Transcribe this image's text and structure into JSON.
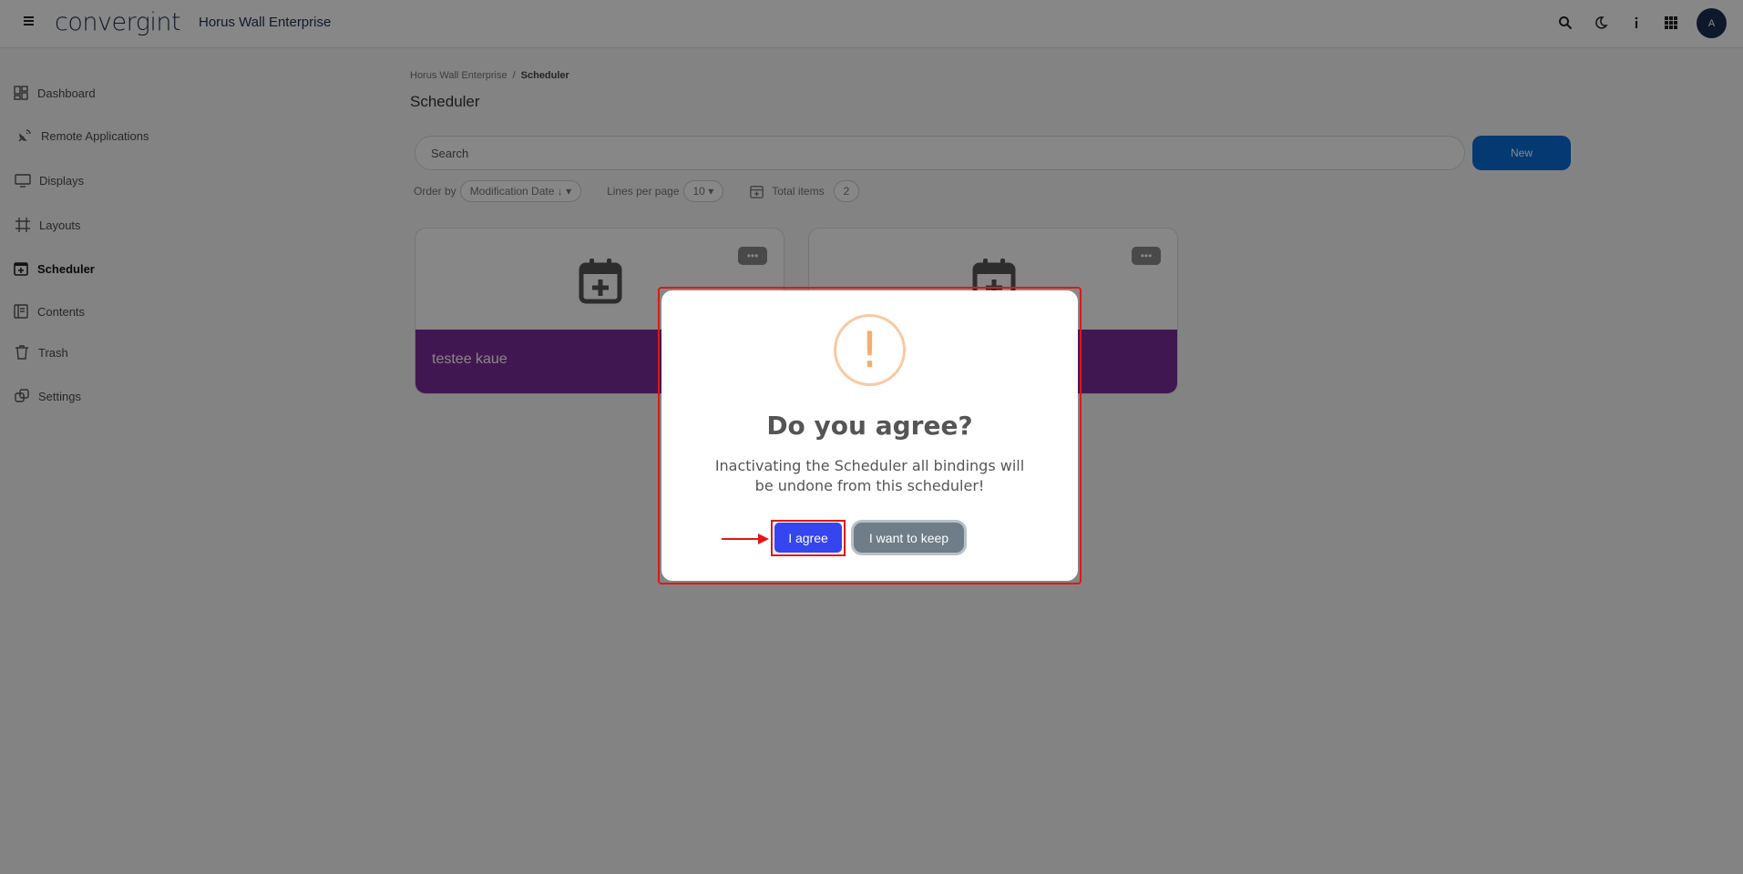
{
  "header": {
    "logo": "convergint",
    "app_title": "Horus Wall Enterprise",
    "icons": [
      "search-icon",
      "moon-icon",
      "info-icon",
      "apps-grid-icon"
    ],
    "avatar_initial": "A"
  },
  "sidebar": {
    "items": [
      {
        "label": "Dashboard",
        "icon": "dashboard-icon"
      },
      {
        "label": "Remote Applications",
        "icon": "satellite-icon"
      },
      {
        "label": "Displays",
        "icon": "monitor-icon"
      },
      {
        "label": "Layouts",
        "icon": "crop-icon"
      },
      {
        "label": "Scheduler",
        "icon": "calendar-plus-icon",
        "active": true
      },
      {
        "label": "Contents",
        "icon": "contents-icon"
      },
      {
        "label": "Trash",
        "icon": "trash-icon"
      },
      {
        "label": "Settings",
        "icon": "settings-icon"
      }
    ]
  },
  "main": {
    "breadcrumb": {
      "root": "Horus Wall Enterprise",
      "separator": "/",
      "current": "Scheduler"
    },
    "title": "Scheduler",
    "search_placeholder": "Search",
    "new_button": "New",
    "filters": {
      "order_by_label": "Order by",
      "order_by_value": "Modification Date ↓",
      "lines_per_page_label": "Lines per page",
      "lines_per_page_value": "10",
      "total_items_label": "Total items",
      "total_items_value": "2"
    },
    "cards": [
      {
        "name": "testee kaue",
        "more": "•••"
      },
      {
        "name": "",
        "more": "•••"
      }
    ]
  },
  "modal": {
    "title": "Do you agree?",
    "message": "Inactivating the Scheduler all bindings will be undone from this scheduler!",
    "icon": "!",
    "confirm_label": "I agree",
    "cancel_label": "I want to keep"
  },
  "colors": {
    "accent": "#0b6dd8",
    "card_band": "#7b2d99",
    "confirm": "#3545f0",
    "cancel": "#6e7d88",
    "warning": "#f6ad6f",
    "highlight": "#e01717"
  }
}
